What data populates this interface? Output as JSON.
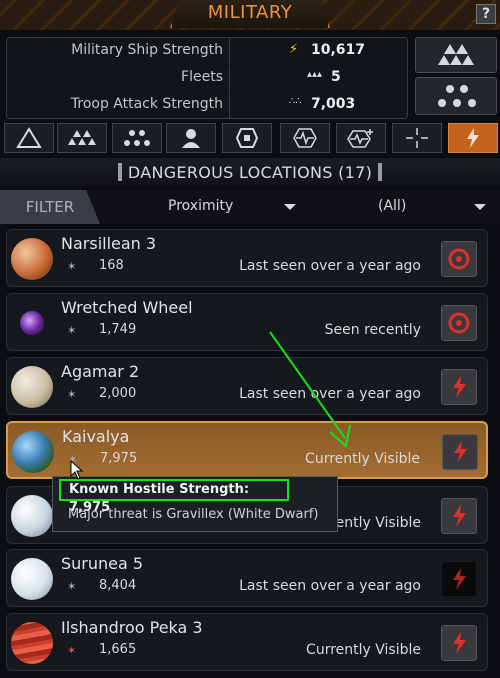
{
  "window": {
    "title": "MILITARY",
    "help_label": "?"
  },
  "stats": [
    {
      "label": "Military Ship Strength",
      "icon": "lightning-icon",
      "value": "10,617"
    },
    {
      "label": "Fleets",
      "icon": "fleet-icon",
      "value": "5"
    },
    {
      "label": "Troop Attack Strength",
      "icon": "troops-icon",
      "value": "7,003"
    }
  ],
  "tabs": [
    {
      "name": "triangle",
      "active": false
    },
    {
      "name": "fleet-formation",
      "active": false
    },
    {
      "name": "dot-grid",
      "active": false
    },
    {
      "name": "person",
      "active": false
    },
    {
      "name": "shield",
      "active": false
    },
    {
      "name": "waveform",
      "active": false
    },
    {
      "name": "waveform-plus",
      "active": false
    },
    {
      "name": "crosshair",
      "active": false
    },
    {
      "name": "lightning",
      "active": true
    }
  ],
  "section": {
    "title": "DANGEROUS LOCATIONS (17)"
  },
  "filter": {
    "label": "FILTER",
    "sort_value": "Proximity",
    "scope_value": "(All)"
  },
  "locations": [
    {
      "name": "Narsillean 3",
      "strength": "168",
      "status": "Last seen over a year ago",
      "action_icon": "target-icon"
    },
    {
      "name": "Wretched Wheel",
      "strength": "1,749",
      "status": "Seen recently",
      "action_icon": "target-icon"
    },
    {
      "name": "Agamar 2",
      "strength": "2,000",
      "status": "Last seen over a year ago",
      "action_icon": "lightning-icon"
    },
    {
      "name": "Kaivalya",
      "strength": "7,975",
      "status": "Currently Visible",
      "action_icon": "lightning-icon",
      "selected": true
    },
    {
      "name": "",
      "strength": "",
      "status": "Currently Visible",
      "action_icon": "lightning-icon"
    },
    {
      "name": "Surunea 5",
      "strength": "8,404",
      "status": "Last seen over a year ago",
      "action_icon": "lightning-icon"
    },
    {
      "name": "Ilshandroo Peka 3",
      "strength": "1,665",
      "status": "Currently Visible",
      "action_icon": "lightning-icon"
    }
  ],
  "tooltip": {
    "title": "Known Hostile Strength: 7,975",
    "body": "Major threat is Gravillex (White Dwarf)"
  },
  "colors": {
    "accent": "#f0913d",
    "selected_row": "#a36d31",
    "annotation": "#16e116",
    "action_red": "#e0302a"
  }
}
